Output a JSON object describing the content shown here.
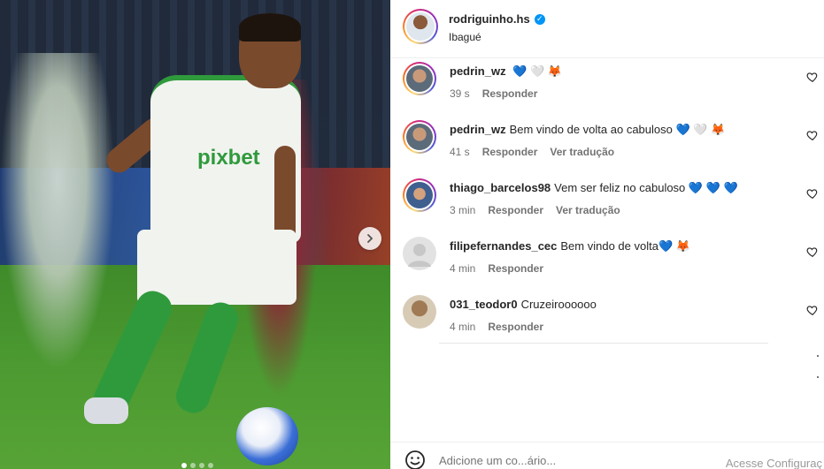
{
  "post": {
    "author": "rodriguinho.hs",
    "location": "Ibagué",
    "verified": true,
    "carousel": {
      "total_slides": 4,
      "active_slide": 1
    }
  },
  "comments": [
    {
      "user": "pedrin_wz",
      "text": "",
      "emojis": [
        "💙",
        "🤍",
        "🦊"
      ],
      "time": "39 s",
      "reply_label": "Responder",
      "translate_label": ""
    },
    {
      "user": "pedrin_wz",
      "text": "Bem vindo de volta ao cabuloso",
      "emojis": [
        "💙",
        "🤍",
        "🦊"
      ],
      "time": "41 s",
      "reply_label": "Responder",
      "translate_label": "Ver tradução"
    },
    {
      "user": "thiago_barcelos98",
      "text": "Vem ser feliz no cabuloso",
      "emojis": [
        "💙",
        "💙",
        "💙"
      ],
      "time": "3 min",
      "reply_label": "Responder",
      "translate_label": "Ver tradução"
    },
    {
      "user": "filipefernandes_cec",
      "text": "Bem vindo de volta",
      "emojis": [
        "💙",
        "🦊"
      ],
      "time": "4 min",
      "reply_label": "Responder",
      "translate_label": ""
    },
    {
      "user": "031_teodor0",
      "text": "Cruzeiroooooo",
      "emojis": [],
      "time": "4 min",
      "reply_label": "Responder",
      "translate_label": ""
    }
  ],
  "footer": {
    "add_comment_placeholder": "Adicione um co...ário...",
    "watermark": "Acesse Configuraç"
  },
  "colors": {
    "link_blue": "#0095f6",
    "meta_grey": "#737373",
    "team_green": "#2f9a3c"
  },
  "icons": {
    "next": "chevron-right-icon",
    "like": "heart-outline-icon",
    "emoji": "smiley-icon",
    "verified": "verified-badge-icon"
  }
}
